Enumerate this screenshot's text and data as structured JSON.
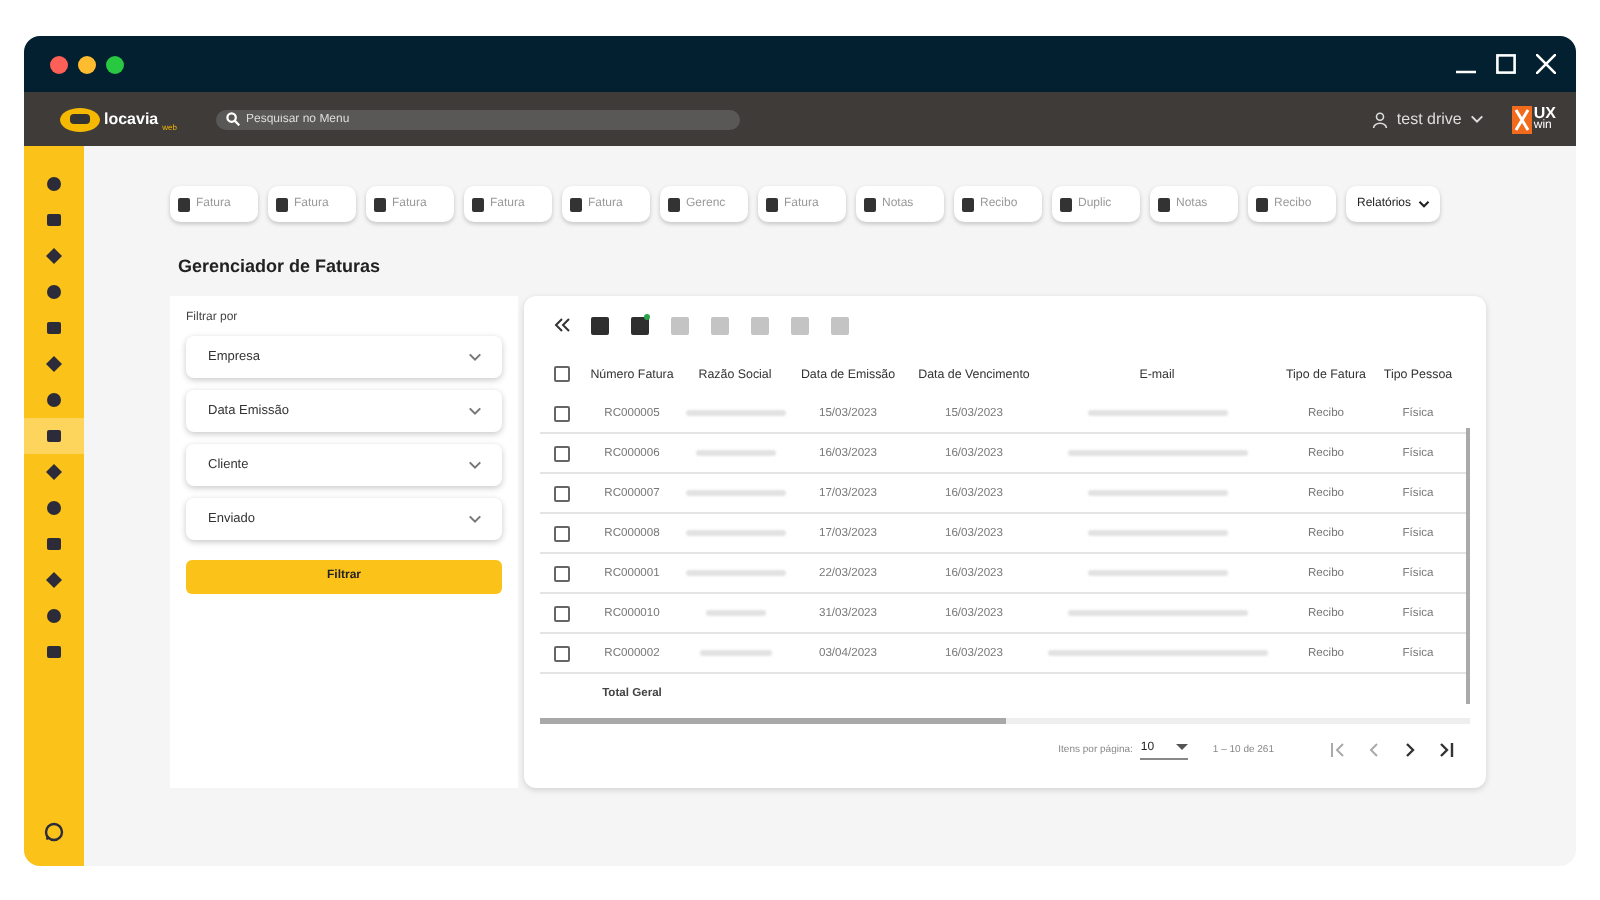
{
  "header": {
    "search": {
      "placeholder": "Pesquisar no Menu"
    },
    "user": "test drive",
    "logo": {
      "name": "locavia",
      "sub": "web"
    },
    "brand": {
      "top": "UX",
      "bottom": "win"
    }
  },
  "sidebar": {
    "items": [
      {
        "selected": false
      },
      {
        "selected": false
      },
      {
        "selected": false
      },
      {
        "selected": false
      },
      {
        "selected": false
      },
      {
        "selected": false
      },
      {
        "selected": false
      },
      {
        "selected": true
      },
      {
        "selected": false
      },
      {
        "selected": false
      },
      {
        "selected": false
      },
      {
        "selected": false
      },
      {
        "selected": false
      },
      {
        "selected": false
      }
    ]
  },
  "tabs": [
    {
      "label": "Fatura"
    },
    {
      "label": "Fatura"
    },
    {
      "label": "Fatura"
    },
    {
      "label": "Fatura"
    },
    {
      "label": "Fatura"
    },
    {
      "label": "Gerenc"
    },
    {
      "label": "Fatura"
    },
    {
      "label": "Notas"
    },
    {
      "label": "Recibo"
    },
    {
      "label": "Duplic"
    },
    {
      "label": "Notas"
    },
    {
      "label": "Recibo"
    }
  ],
  "reports_menu": "Relatórios",
  "page_title": "Gerenciador de Faturas",
  "filter": {
    "title": "Filtrar por",
    "fields": [
      "Empresa",
      "Data Emissão",
      "Cliente",
      "Enviado"
    ],
    "button": "Filtrar"
  },
  "toolbar": [
    {
      "disabled": false
    },
    {
      "disabled": false
    },
    {
      "disabled": true
    },
    {
      "disabled": true
    },
    {
      "disabled": true
    },
    {
      "disabled": true
    },
    {
      "disabled": true
    }
  ],
  "table": {
    "select_all_checked": false,
    "columns": [
      "Número Fatura",
      "Razão Social",
      "Data de Emissão",
      "Data de Vencimento",
      "E-mail",
      "Tipo de Fatura",
      "Tipo Pessoa"
    ],
    "rows": [
      {
        "checked": false,
        "numero": "RC000005",
        "emissao": "15/03/2023",
        "vencimento": "15/03/2023",
        "tipo": "Recibo",
        "pessoa": "Física"
      },
      {
        "checked": false,
        "numero": "RC000006",
        "emissao": "16/03/2023",
        "vencimento": "16/03/2023",
        "tipo": "Recibo",
        "pessoa": "Física"
      },
      {
        "checked": false,
        "numero": "RC000007",
        "emissao": "17/03/2023",
        "vencimento": "16/03/2023",
        "tipo": "Recibo",
        "pessoa": "Física"
      },
      {
        "checked": false,
        "numero": "RC000008",
        "emissao": "17/03/2023",
        "vencimento": "16/03/2023",
        "tipo": "Recibo",
        "pessoa": "Física"
      },
      {
        "checked": false,
        "numero": "RC000001",
        "emissao": "22/03/2023",
        "vencimento": "16/03/2023",
        "tipo": "Recibo",
        "pessoa": "Física"
      },
      {
        "checked": false,
        "numero": "RC000010",
        "emissao": "31/03/2023",
        "vencimento": "16/03/2023",
        "tipo": "Recibo",
        "pessoa": "Física"
      },
      {
        "checked": false,
        "numero": "RC000002",
        "emissao": "03/04/2023",
        "vencimento": "16/03/2023",
        "tipo": "Recibo",
        "pessoa": "Física"
      }
    ],
    "total_label": "Total Geral"
  },
  "paginator": {
    "label": "Itens por página:",
    "page_size": "10",
    "range": "1 – 10 de 261"
  }
}
